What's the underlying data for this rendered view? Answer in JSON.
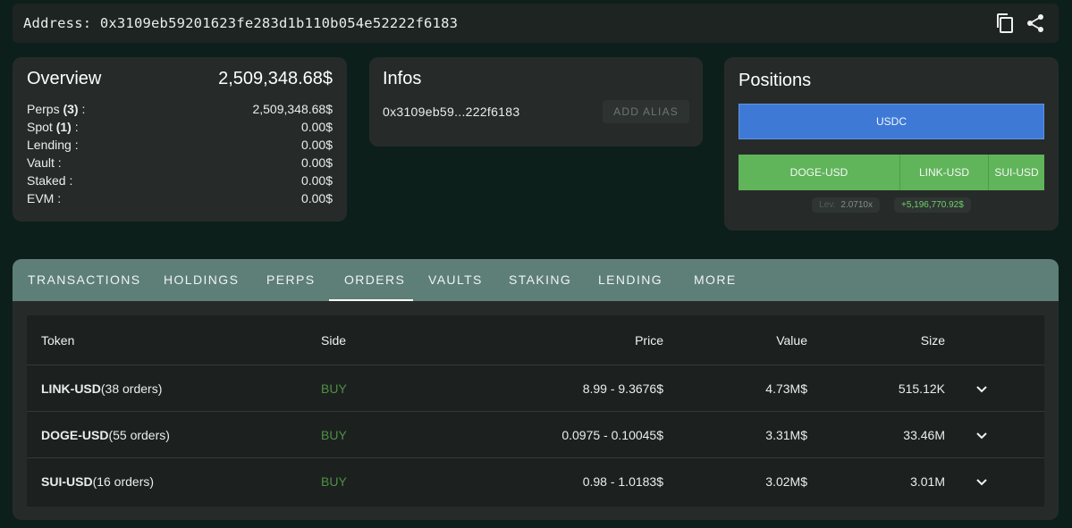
{
  "address": {
    "label": "Address:",
    "value": "0x3109eb59201623fe283d1b110b054e52222f6183",
    "icons": [
      "copy-icon",
      "share-icon"
    ]
  },
  "overview": {
    "title": "Overview",
    "total": "2,509,348.68$",
    "rows": [
      {
        "label": "Perps",
        "count": "(3)",
        "suffix": " :",
        "value": "2,509,348.68$"
      },
      {
        "label": "Spot",
        "count": "(1)",
        "suffix": " :",
        "value": "0.00$"
      },
      {
        "label": "Lending",
        "count": "",
        "suffix": " :",
        "value": "0.00$"
      },
      {
        "label": "Vault",
        "count": "",
        "suffix": " :",
        "value": "0.00$"
      },
      {
        "label": "Staked",
        "count": "",
        "suffix": " :",
        "value": "0.00$"
      },
      {
        "label": "EVM",
        "count": "",
        "suffix": " :",
        "value": "0.00$"
      }
    ]
  },
  "infos": {
    "title": "Infos",
    "short_address": "0x3109eb59...222f6183",
    "alias_button": "ADD ALIAS"
  },
  "positions": {
    "title": "Positions",
    "spot": {
      "label": "USDC"
    },
    "perps": [
      {
        "label": "DOGE-USD",
        "share": 0.53
      },
      {
        "label": "LINK-USD",
        "share": 0.29
      },
      {
        "label": "SUI-USD",
        "share": 0.18
      }
    ],
    "lev_label": "Lev.",
    "lev_value": "2.0710x",
    "pnl": "+5,196,770.92$",
    "colors": {
      "spot": "#3e79d6",
      "perps": "#60b45a",
      "pnl": "#6fcf6a"
    }
  },
  "tabs": {
    "items": [
      "TRANSACTIONS",
      "HOLDINGS",
      "PERPS",
      "ORDERS",
      "VAULTS",
      "STAKING",
      "LENDING",
      "MORE"
    ],
    "active": "ORDERS"
  },
  "orders": {
    "headers": {
      "token": "Token",
      "side": "Side",
      "price": "Price",
      "value": "Value",
      "size": "Size"
    },
    "rows": [
      {
        "token": "LINK-USD",
        "orders": "(38 orders)",
        "side": "BUY",
        "price": "8.99 - 9.3676$",
        "value": "4.73M$",
        "size": "515.12K"
      },
      {
        "token": "DOGE-USD",
        "orders": "(55 orders)",
        "side": "BUY",
        "price": "0.0975 - 0.10045$",
        "value": "3.31M$",
        "size": "33.46M"
      },
      {
        "token": "SUI-USD",
        "orders": "(16 orders)",
        "side": "BUY",
        "price": "0.98 - 1.0183$",
        "value": "3.02M$",
        "size": "3.01M"
      }
    ],
    "colors": {
      "buy": "#4f8f45"
    }
  }
}
